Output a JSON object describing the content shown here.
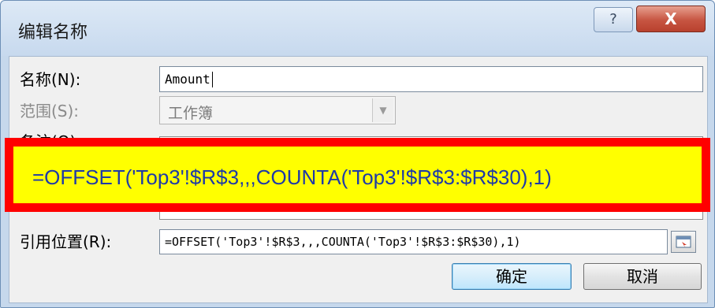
{
  "window": {
    "title": "编辑名称",
    "help_label": "?",
    "close_label": "X"
  },
  "form": {
    "name_label": "名称(N):",
    "name_value": "Amount",
    "scope_label": "范围(S):",
    "scope_value": "工作簿",
    "comment_label": "备注(O):",
    "refers_label": "引用位置(R):",
    "refers_value": "=OFFSET('Top3'!$R$3,,,COUNTA('Top3'!$R$3:$R$30),1)"
  },
  "callout": {
    "text": "=OFFSET('Top3'!$R$3,,,COUNTA('Top3'!$R$3:$R$30),1)"
  },
  "buttons": {
    "ok_label": "确定",
    "cancel_label": "取消"
  },
  "colors": {
    "callout_fill": "#ffff00",
    "callout_border": "#ff0000",
    "callout_text": "#1e3aa8",
    "close_button": "#c75542"
  }
}
